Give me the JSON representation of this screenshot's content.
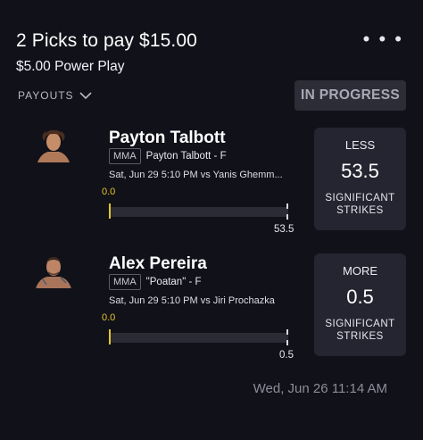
{
  "header": {
    "title": "2 Picks to pay $15.00",
    "subtitle": "$5.00 Power Play",
    "payouts_label": "PAYOUTS",
    "status": "IN PROGRESS"
  },
  "picks": [
    {
      "name": "Payton Talbott",
      "league": "MMA",
      "detail": "Payton Talbott - F",
      "meta": "Sat, Jun 29 5:10 PM  vs Yanis Ghemm...",
      "current": "0.0",
      "line": "53.5",
      "direction": "LESS",
      "stat_line1": "SIGNIFICANT",
      "stat_line2": "STRIKES"
    },
    {
      "name": "Alex Pereira",
      "league": "MMA",
      "detail": "\"Poatan\" - F",
      "meta": "Sat, Jun 29 5:10 PM  vs Jiri Prochazka",
      "current": "0.0",
      "line": "0.5",
      "direction": "MORE",
      "stat_line1": "SIGNIFICANT",
      "stat_line2": "STRIKES"
    }
  ],
  "footer": {
    "timestamp": "Wed, Jun 26 11:14 AM"
  },
  "colors": {
    "background": "#111119",
    "panel": "#242530",
    "accent_yellow": "#e3c52a",
    "status_bg": "#2c2d37"
  },
  "icons": [
    "more-options-icon",
    "chevron-down-icon",
    "player-avatar"
  ]
}
